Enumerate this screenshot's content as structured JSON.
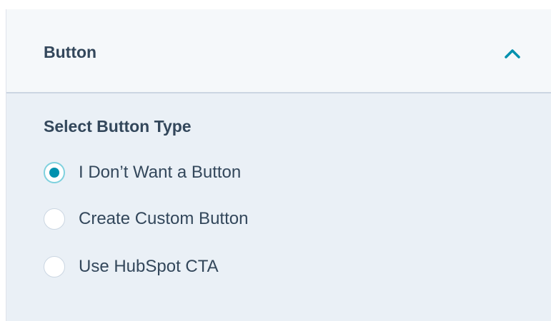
{
  "panel": {
    "title": "Button",
    "expanded": true,
    "chevron_icon": "chevron-up-icon"
  },
  "button_type": {
    "heading": "Select Button Type",
    "options": [
      {
        "label": "I Don’t Want a Button",
        "checked": true
      },
      {
        "label": "Create Custom Button",
        "checked": false
      },
      {
        "label": "Use HubSpot CTA",
        "checked": false
      }
    ]
  },
  "colors": {
    "accent": "#0091ae",
    "text": "#33475b",
    "body_background": "#eaf0f6",
    "header_background": "#f5f8fa"
  }
}
